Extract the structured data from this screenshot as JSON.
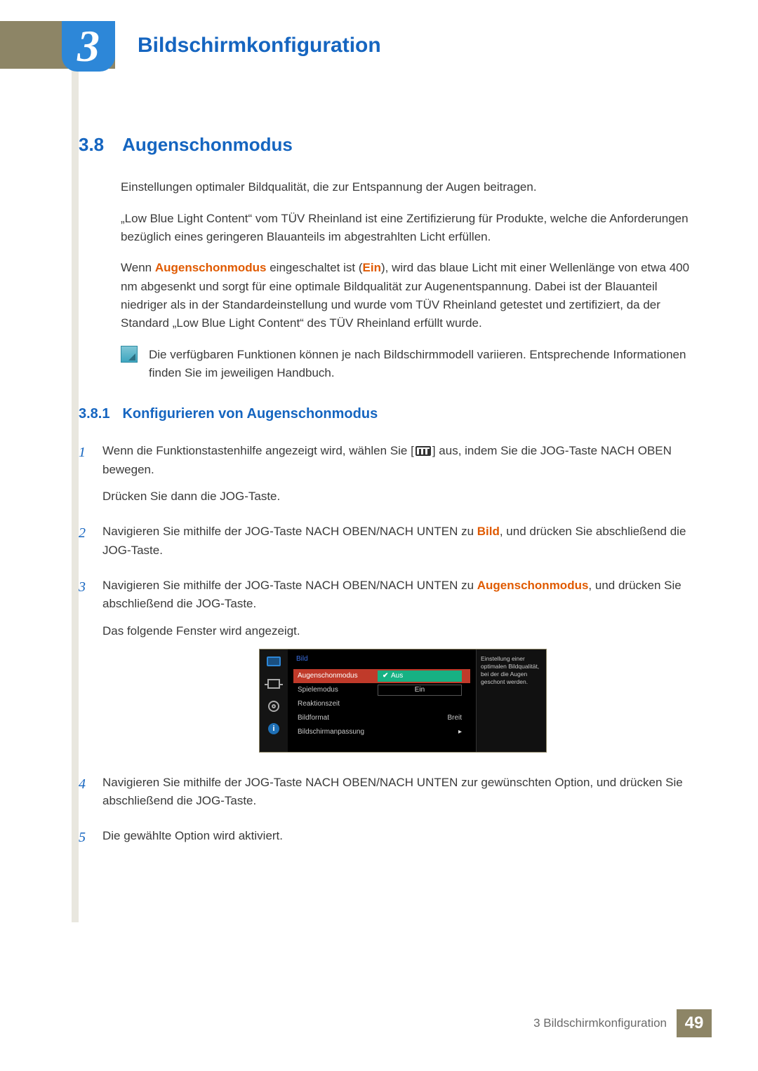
{
  "chapter": {
    "number": "3",
    "title": "Bildschirmkonfiguration"
  },
  "section": {
    "number": "3.8",
    "title": "Augenschonmodus"
  },
  "intro": {
    "p1": "Einstellungen optimaler Bildqualität, die zur Entspannung der Augen beitragen.",
    "p2": "„Low Blue Light Content“ vom TÜV Rheinland ist eine Zertifizierung für Produkte, welche die Anforderungen bezüglich eines geringeren Blauanteils im abgestrahlten Licht erfüllen.",
    "p3a": "Wenn ",
    "p3_hl1": "Augenschonmodus",
    "p3b": " eingeschaltet ist (",
    "p3_hl2": "Ein",
    "p3c": "), wird das blaue Licht mit einer Wellenlänge von etwa 400 nm abgesenkt und sorgt für eine optimale Bildqualität zur Augenentspannung. Dabei ist der Blauanteil niedriger als in der Standardeinstellung und wurde vom TÜV Rheinland getestet und zertifiziert, da der Standard „Low Blue Light Content“ des TÜV Rheinland erfüllt wurde."
  },
  "note": "Die verfügbaren Funktionen können je nach Bildschirmmodell variieren. Entsprechende Informationen finden Sie im jeweiligen Handbuch.",
  "subsection": {
    "number": "3.8.1",
    "title": "Konfigurieren von Augenschonmodus"
  },
  "steps": {
    "s1": {
      "n": "1",
      "a": "Wenn die Funktionstastenhilfe angezeigt wird, wählen Sie [",
      "b": "] aus, indem Sie die JOG-Taste NACH OBEN bewegen.",
      "c": "Drücken Sie dann die JOG-Taste."
    },
    "s2": {
      "n": "2",
      "a": "Navigieren Sie mithilfe der JOG-Taste NACH OBEN/NACH UNTEN zu ",
      "hl": "Bild",
      "b": ", und drücken Sie abschließend die JOG-Taste."
    },
    "s3": {
      "n": "3",
      "a": "Navigieren Sie mithilfe der JOG-Taste NACH OBEN/NACH UNTEN zu ",
      "hl": "Augenschonmodus",
      "b": ", und drücken Sie abschließend die JOG-Taste.",
      "c": "Das folgende Fenster wird angezeigt."
    },
    "s4": {
      "n": "4",
      "a": "Navigieren Sie mithilfe der JOG-Taste NACH OBEN/NACH UNTEN zur gewünschten Option, und drücken Sie abschließend die JOG-Taste."
    },
    "s5": {
      "n": "5",
      "a": "Die gewählte Option wird aktiviert."
    }
  },
  "osd": {
    "title": "Bild",
    "rows": {
      "r1": {
        "label": "Augenschonmodus",
        "value": "Aus"
      },
      "r2": {
        "label": "Spielemodus",
        "value": "Ein"
      },
      "r3": {
        "label": "Reaktionszeit",
        "value": ""
      },
      "r4": {
        "label": "Bildformat",
        "value": "Breit"
      },
      "r5": {
        "label": "Bildschirmanpassung",
        "value": "▸"
      }
    },
    "help": "Einstellung einer optimalen Bildqualität, bei der die Augen geschont werden."
  },
  "footer": {
    "label": "3 Bildschirmkonfiguration",
    "page": "49"
  }
}
